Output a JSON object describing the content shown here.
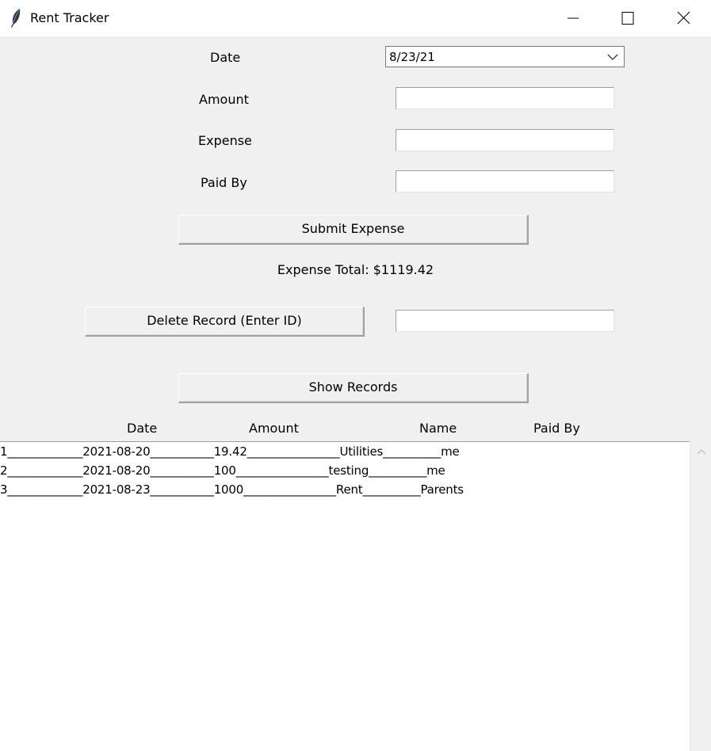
{
  "window": {
    "title": "Rent Tracker"
  },
  "form": {
    "date_label": "Date",
    "date_value": "8/23/21",
    "amount_label": "Amount",
    "amount_value": "",
    "expense_label": "Expense",
    "expense_value": "",
    "paid_by_label": "Paid By",
    "paid_by_value": ""
  },
  "buttons": {
    "submit": "Submit Expense",
    "delete": "Delete Record (Enter ID)",
    "show": "Show Records"
  },
  "delete_id_value": "",
  "expense_total": "Expense Total: $1119.42",
  "records": {
    "headers": [
      "Date",
      "Amount",
      "Name",
      "Paid By"
    ],
    "rows": [
      "1_____________2021-08-20___________19.42________________Utilities__________me",
      "2_____________2021-08-20___________100________________testing__________me",
      "3_____________2021-08-23___________1000________________Rent__________Parents"
    ]
  }
}
